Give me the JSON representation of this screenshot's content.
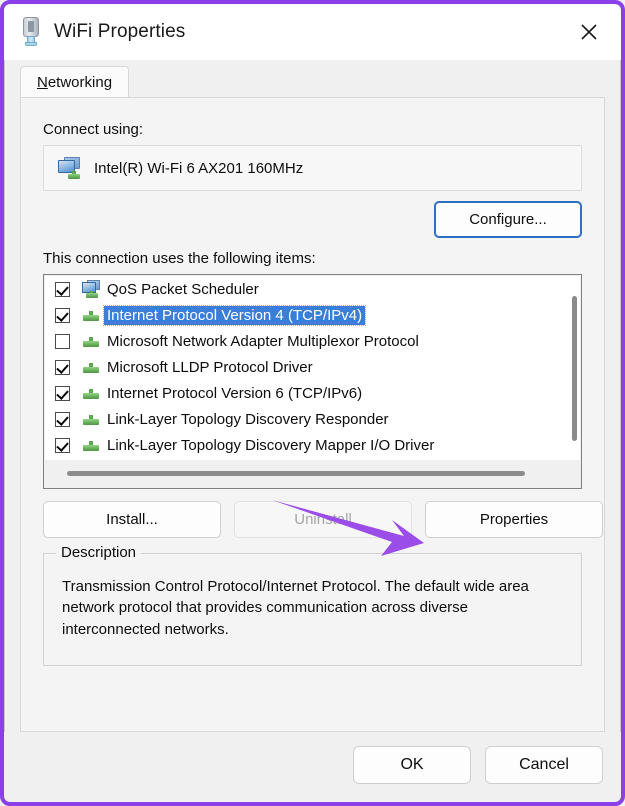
{
  "window": {
    "title": "WiFi Properties",
    "title_icon": "usb-network-adapter-icon",
    "close_icon": "close-icon",
    "border_color": "#8b3fe8"
  },
  "tabs": [
    {
      "label": "Networking",
      "accelerator": "N",
      "active": true
    }
  ],
  "connect": {
    "label": "Connect using:",
    "adapter_name": "Intel(R) Wi-Fi 6 AX201 160MHz",
    "adapter_icon": "network-adapter-icon",
    "configure_label": "Configure...",
    "configure_focus_color": "#2d6fc0"
  },
  "items_section": {
    "label": "This connection uses the following items:",
    "selection_color": "#3a7fd5",
    "items": [
      {
        "label": "QoS Packet Scheduler",
        "checked": true,
        "selected": false,
        "icon": "qos-monitor-plug-icon"
      },
      {
        "label": "Internet Protocol Version 4 (TCP/IPv4)",
        "checked": true,
        "selected": true,
        "icon": "protocol-plug-icon"
      },
      {
        "label": "Microsoft Network Adapter Multiplexor Protocol",
        "checked": false,
        "selected": false,
        "icon": "protocol-plug-icon"
      },
      {
        "label": "Microsoft LLDP Protocol Driver",
        "checked": true,
        "selected": false,
        "icon": "protocol-plug-icon"
      },
      {
        "label": "Internet Protocol Version 6 (TCP/IPv6)",
        "checked": true,
        "selected": false,
        "icon": "protocol-plug-icon"
      },
      {
        "label": "Link-Layer Topology Discovery Responder",
        "checked": true,
        "selected": false,
        "icon": "protocol-plug-icon"
      },
      {
        "label": "Link-Layer Topology Discovery Mapper I/O Driver",
        "checked": true,
        "selected": false,
        "icon": "protocol-plug-icon"
      }
    ]
  },
  "item_buttons": {
    "install": "Install...",
    "uninstall": "Uninstall",
    "uninstall_disabled": true,
    "properties": "Properties"
  },
  "description": {
    "legend": "Description",
    "text": "Transmission Control Protocol/Internet Protocol. The default wide area network protocol that provides communication across diverse interconnected networks."
  },
  "footer": {
    "ok": "OK",
    "cancel": "Cancel"
  },
  "annotation": {
    "arrow_color": "#9b4dea",
    "points_to": "properties-button"
  }
}
